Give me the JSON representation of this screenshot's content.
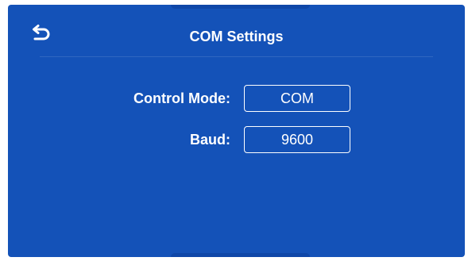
{
  "header": {
    "title": "COM Settings",
    "back_icon": "back-arrow-icon"
  },
  "settings": {
    "control_mode": {
      "label": "Control Mode:",
      "value": "COM"
    },
    "baud": {
      "label": "Baud:",
      "value": "9600"
    }
  },
  "colors": {
    "background": "#1452b8",
    "text": "#ffffff"
  }
}
